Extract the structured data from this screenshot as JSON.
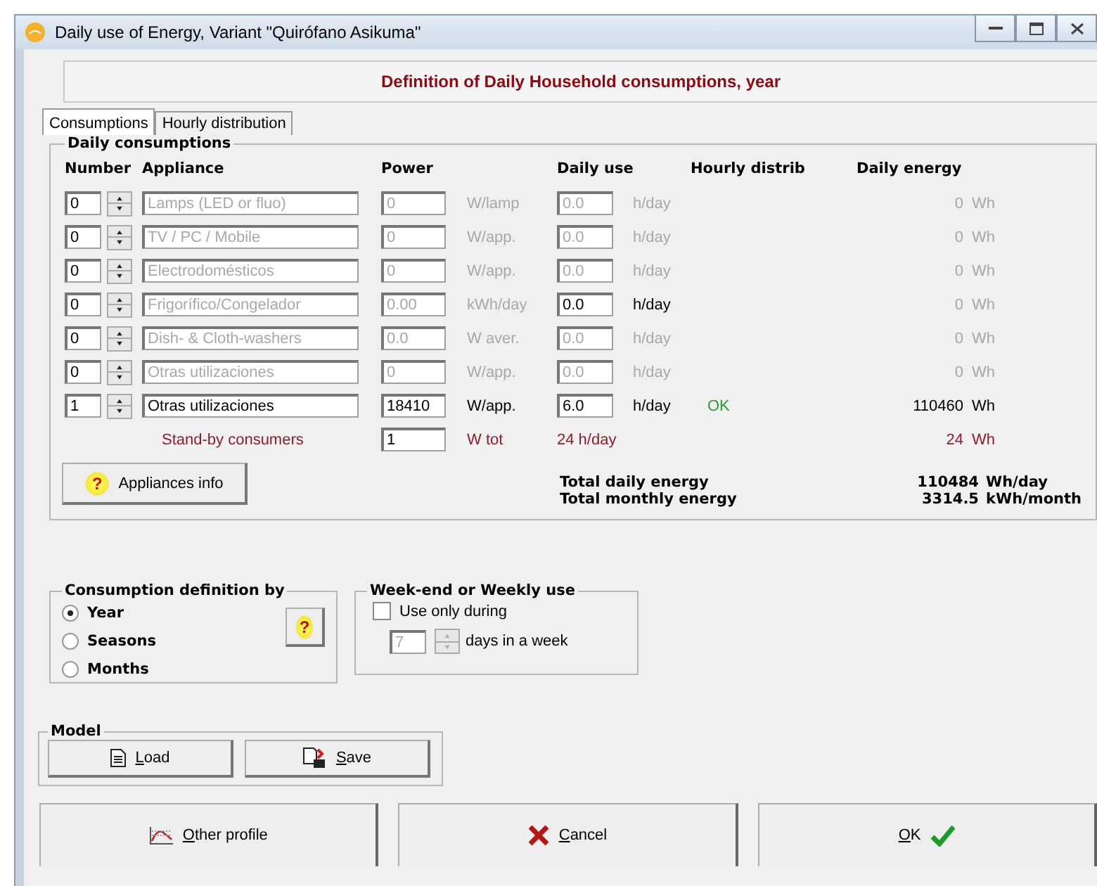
{
  "window": {
    "title": "Daily use of Energy, Variant  \"Quirófano Asikuma\""
  },
  "header": "Definition of Daily Household consumptions, year",
  "tabs": [
    {
      "label": "Consumptions",
      "selected": true
    },
    {
      "label": "Hourly distribution",
      "selected": false
    }
  ],
  "daily_consumptions": {
    "title": "Daily consumptions",
    "columns": [
      "Number",
      "Appliance",
      "Power",
      "Daily use",
      "Hourly distrib",
      "Daily energy"
    ],
    "rows": [
      {
        "number": "0",
        "appliance": "Lamps (LED or fluo)",
        "power": "0",
        "power_unit": "W/lamp",
        "use": "0.0",
        "use_unit": "h/day",
        "energy": "0",
        "energy_unit": "Wh",
        "disabled": true,
        "use_disabled": true
      },
      {
        "number": "0",
        "appliance": "TV / PC / Mobile",
        "power": "0",
        "power_unit": "W/app.",
        "use": "0.0",
        "use_unit": "h/day",
        "energy": "0",
        "energy_unit": "Wh",
        "disabled": true,
        "use_disabled": true
      },
      {
        "number": "0",
        "appliance": "Electrodomésticos",
        "power": "0",
        "power_unit": "W/app.",
        "use": "0.0",
        "use_unit": "h/day",
        "energy": "0",
        "energy_unit": "Wh",
        "disabled": true,
        "use_disabled": true
      },
      {
        "number": "0",
        "appliance": "Frigorífico/Congelador",
        "power": "0.00",
        "power_unit": "kWh/day",
        "use": "0.0",
        "use_unit": "h/day",
        "energy": "0",
        "energy_unit": "Wh",
        "disabled": true,
        "use_disabled": false
      },
      {
        "number": "0",
        "appliance": "Dish- & Cloth-washers",
        "power": "0.0",
        "power_unit": "W aver.",
        "use": "0.0",
        "use_unit": "h/day",
        "energy": "0",
        "energy_unit": "Wh",
        "disabled": true,
        "use_disabled": true
      },
      {
        "number": "0",
        "appliance": "Otras utilizaciones",
        "power": "0",
        "power_unit": "W/app.",
        "use": "0.0",
        "use_unit": "h/day",
        "energy": "0",
        "energy_unit": "Wh",
        "disabled": true,
        "use_disabled": true
      },
      {
        "number": "1",
        "appliance": "Otras utilizaciones",
        "power": "18410",
        "power_unit": "W/app.",
        "use": "6.0",
        "use_unit": "h/day",
        "hourly": "OK",
        "energy": "110460",
        "energy_unit": "Wh",
        "disabled": false,
        "use_disabled": false
      }
    ],
    "standby": {
      "label": "Stand-by consumers",
      "power": "1",
      "power_unit": "W tot",
      "use": "24 h/day",
      "energy": "24",
      "energy_unit": "Wh"
    },
    "info_icon": "?",
    "info_button": "Appliances info",
    "totals": [
      {
        "label": "Total daily energy",
        "value": "110484",
        "unit": "Wh/day"
      },
      {
        "label": "Total monthly energy",
        "value": "3314.5",
        "unit": "kWh/month"
      }
    ]
  },
  "definition": {
    "title": "Consumption definition by",
    "help_icon": "?",
    "options": [
      {
        "label": "Year",
        "selected": true
      },
      {
        "label": "Seasons",
        "selected": false
      },
      {
        "label": "Months",
        "selected": false
      }
    ]
  },
  "weekly": {
    "title": "Week-end or Weekly use",
    "checkbox": {
      "label": "Use only during",
      "checked": false
    },
    "days": "7",
    "days_label": "days in a week"
  },
  "model": {
    "title": "Model",
    "buttons": [
      "Load",
      "Save"
    ]
  },
  "buttons": [
    {
      "label": "Other profile",
      "kind": "profile"
    },
    {
      "label": "Cancel",
      "kind": "cancel"
    },
    {
      "label": "OK",
      "kind": "ok"
    }
  ]
}
